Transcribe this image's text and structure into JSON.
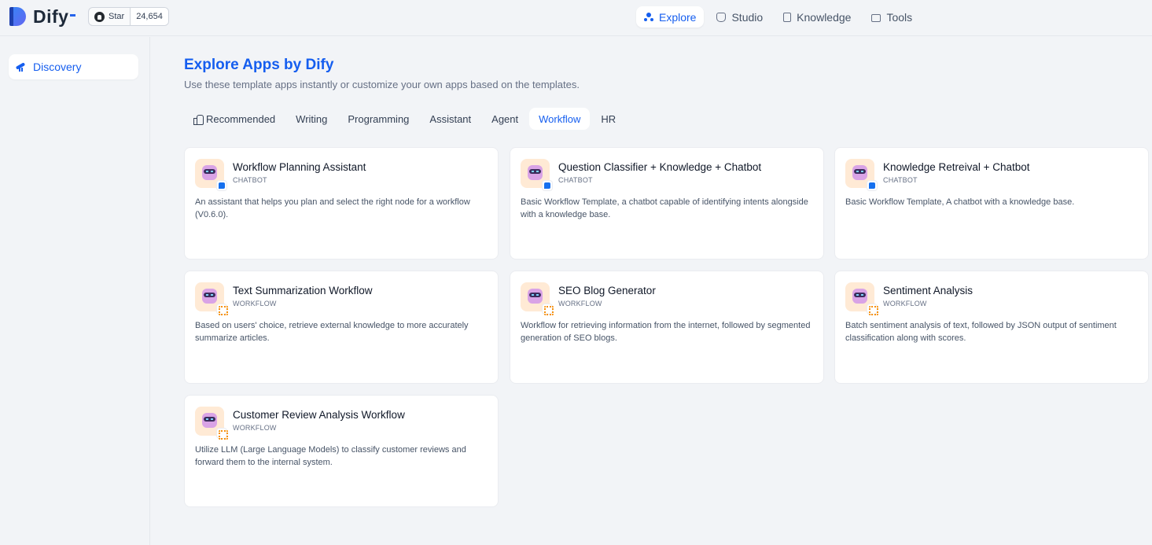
{
  "brand": {
    "name": "Dify"
  },
  "github": {
    "star_label": "Star",
    "count": "24,654"
  },
  "nav": [
    {
      "label": "Explore",
      "icon": "explore-icon",
      "active": true
    },
    {
      "label": "Studio",
      "icon": "studio-icon"
    },
    {
      "label": "Knowledge",
      "icon": "knowledge-icon"
    },
    {
      "label": "Tools",
      "icon": "tools-icon"
    }
  ],
  "sidebar": {
    "items": [
      {
        "label": "Discovery",
        "icon": "telescope-icon",
        "active": true
      }
    ]
  },
  "main": {
    "title": "Explore Apps by Dify",
    "subtitle": "Use these template apps instantly or customize your own apps based on the templates.",
    "tabs": [
      {
        "label": "Recommended",
        "icon": "thumbs-up-icon"
      },
      {
        "label": "Writing"
      },
      {
        "label": "Programming"
      },
      {
        "label": "Assistant"
      },
      {
        "label": "Agent"
      },
      {
        "label": "Workflow",
        "active": true
      },
      {
        "label": "HR"
      }
    ],
    "apps": [
      {
        "title": "Workflow Planning Assistant",
        "type": "CHATBOT",
        "description": "An assistant that helps you plan and select the right node for a workflow (V0.6.0)."
      },
      {
        "title": "Question Classifier + Knowledge + Chatbot",
        "type": "CHATBOT",
        "description": "Basic Workflow Template, a chatbot capable of identifying intents alongside with a knowledge base."
      },
      {
        "title": "Knowledge Retreival + Chatbot",
        "type": "CHATBOT",
        "description": "Basic Workflow Template, A chatbot with a knowledge base."
      },
      {
        "title": "Text Summarization Workflow",
        "type": "WORKFLOW",
        "description": "Based on users' choice, retrieve external knowledge to more accurately summarize articles."
      },
      {
        "title": "SEO Blog Generator",
        "type": "WORKFLOW",
        "description": "Workflow for retrieving information from the internet, followed by segmented generation of SEO blogs."
      },
      {
        "title": "Sentiment Analysis",
        "type": "WORKFLOW",
        "description": "Batch sentiment analysis of text, followed by JSON output of sentiment classification along with scores."
      },
      {
        "title": "Customer Review Analysis Workflow",
        "type": "WORKFLOW",
        "description": "Utilize LLM (Large Language Models) to classify customer reviews and forward them to the internal system."
      }
    ]
  },
  "colors": {
    "accent": "#155eef",
    "background": "#f2f4f7",
    "card": "#ffffff",
    "app_icon_bg": "#ffead5"
  }
}
